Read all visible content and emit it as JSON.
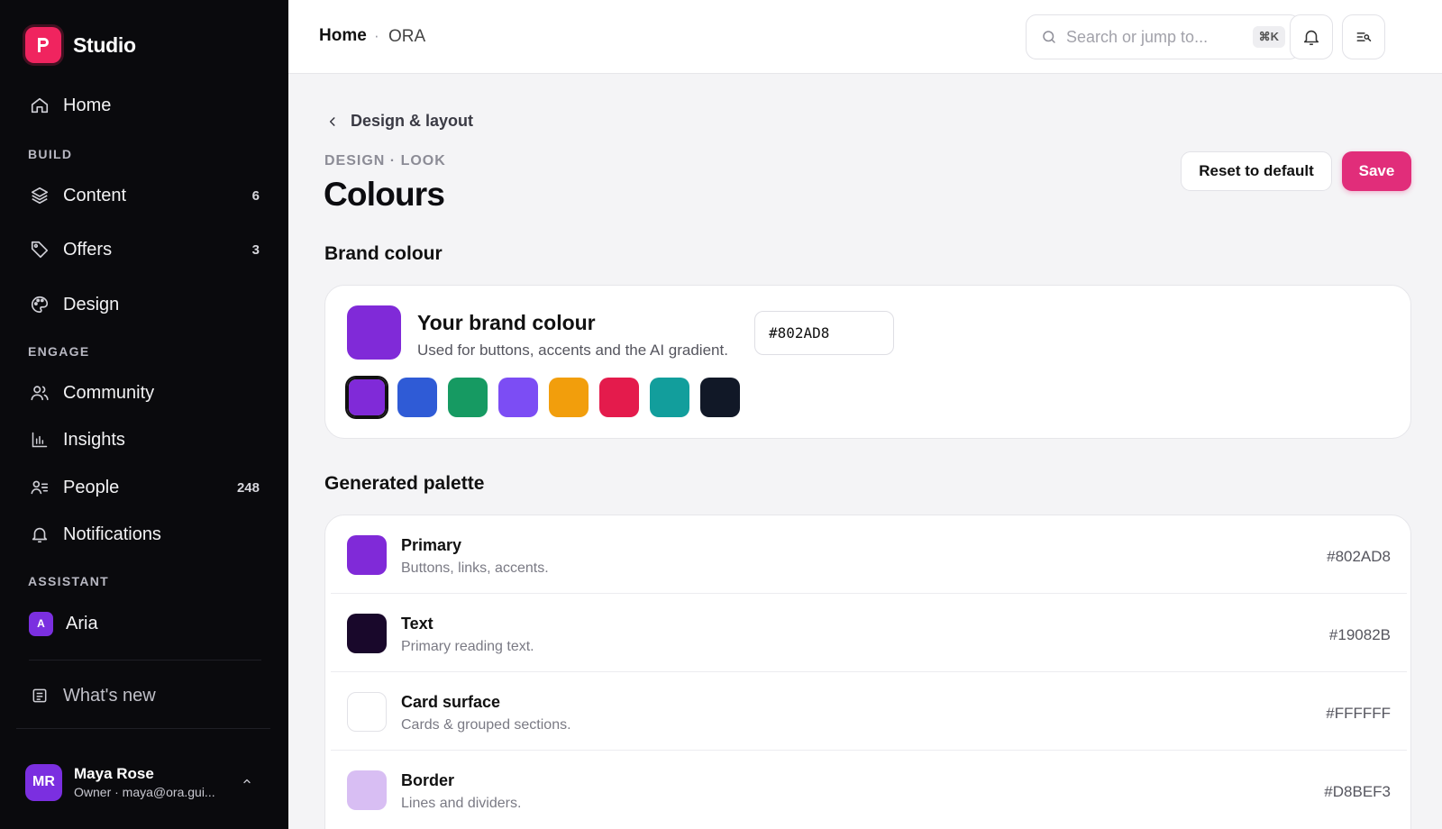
{
  "app": {
    "name": "Studio"
  },
  "sidebar": {
    "home": {
      "label": "Home"
    },
    "sections": {
      "build": "BUILD",
      "engage": "ENGAGE",
      "assistant": "ASSISTANT"
    },
    "build_items": [
      {
        "label": "Content",
        "count": "6",
        "icon": "layers-icon"
      },
      {
        "label": "Offers",
        "count": "3",
        "icon": "tag-icon"
      },
      {
        "label": "Design",
        "count": "",
        "icon": "palette-icon"
      }
    ],
    "engage_items": [
      {
        "label": "Community",
        "count": "",
        "icon": "users-icon"
      },
      {
        "label": "Insights",
        "count": "",
        "icon": "bar-chart-icon"
      },
      {
        "label": "People",
        "count": "248",
        "icon": "user-list-icon"
      },
      {
        "label": "Notifications",
        "count": "",
        "icon": "bell-icon"
      }
    ],
    "assistant": {
      "badge": "A",
      "label": "Aria"
    },
    "whats_new": "What's new",
    "user": {
      "initials": "MR",
      "name": "Maya Rose",
      "subtitle": "Owner · maya@ora.gui..."
    }
  },
  "topbar": {
    "breadcrumb_home": "Home",
    "breadcrumb_sep": "·",
    "breadcrumb_current": "ORA",
    "search_placeholder": "Search or jump to...",
    "search_shortcut": "⌘K"
  },
  "main": {
    "back_label": "Design & layout",
    "eyebrow": "DESIGN · LOOK",
    "title": "Colours",
    "reset_label": "Reset to default",
    "save_label": "Save",
    "brand_section": "Brand colour",
    "brand": {
      "heading": "Your brand colour",
      "description": "Used for buttons, accents and the AI gradient.",
      "hex_value": "#802AD8",
      "swatch_color": "#802AD8",
      "presets": [
        "#802AD8",
        "#2F5BD6",
        "#169A62",
        "#7C4DF4",
        "#F29E0C",
        "#E41B4C",
        "#129E9C",
        "#111827"
      ],
      "selected_index": 0
    },
    "palette_section": "Generated palette",
    "palette": [
      {
        "name": "Primary",
        "description": "Buttons, links, accents.",
        "hex": "#802AD8",
        "color": "#802AD8"
      },
      {
        "name": "Text",
        "description": "Primary reading text.",
        "hex": "#19082B",
        "color": "#19082B"
      },
      {
        "name": "Card surface",
        "description": "Cards & grouped sections.",
        "hex": "#FFFFFF",
        "color": "#FFFFFF"
      },
      {
        "name": "Border",
        "description": "Lines and dividers.",
        "hex": "#D8BEF3",
        "color": "#D8BEF3"
      }
    ]
  }
}
